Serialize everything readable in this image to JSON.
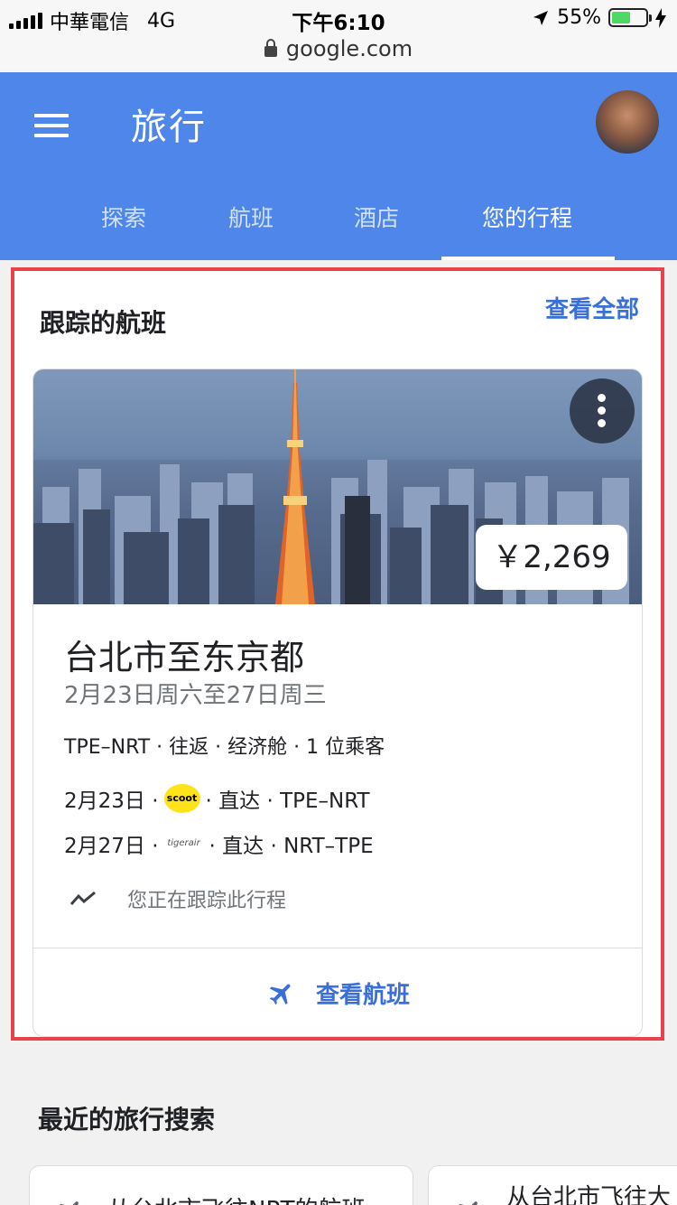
{
  "status_bar": {
    "carrier": "中華電信",
    "network": "4G",
    "time": "下午6:10",
    "battery_percent": "55%",
    "battery_level": 0.55
  },
  "browser": {
    "url": "google.com"
  },
  "header": {
    "title": "旅行",
    "tabs": [
      {
        "label": "探索",
        "active": false
      },
      {
        "label": "航班",
        "active": false
      },
      {
        "label": "酒店",
        "active": false
      },
      {
        "label": "您的行程",
        "active": true
      }
    ]
  },
  "tracked_flights": {
    "section_title": "跟踪的航班",
    "view_all_label": "查看全部",
    "card": {
      "price": "￥2,269",
      "title": "台北市至东京都",
      "dates": "2月23日周六至27日周三",
      "meta": "TPE–NRT · 往返 · 经济舱 · 1 位乘客",
      "legs": [
        {
          "date": "2月23日 ·",
          "airline_logo": "scoot",
          "detail": "· 直达 · TPE–NRT"
        },
        {
          "date": "2月27日 ·",
          "airline_logo": "tigerair",
          "detail": "· 直达 · NRT–TPE"
        }
      ],
      "tracking_text": "您正在跟踪此行程",
      "view_flights_label": "查看航班"
    }
  },
  "recent_searches": {
    "section_title": "最近的旅行搜索",
    "items": [
      {
        "label": "从台北市飞往NRT的航班"
      },
      {
        "label": "从台北市飞往大"
      }
    ]
  },
  "colors": {
    "header_bg": "#4e86ea",
    "link_blue": "#3a6fd8",
    "highlight_red": "#e8424a"
  }
}
